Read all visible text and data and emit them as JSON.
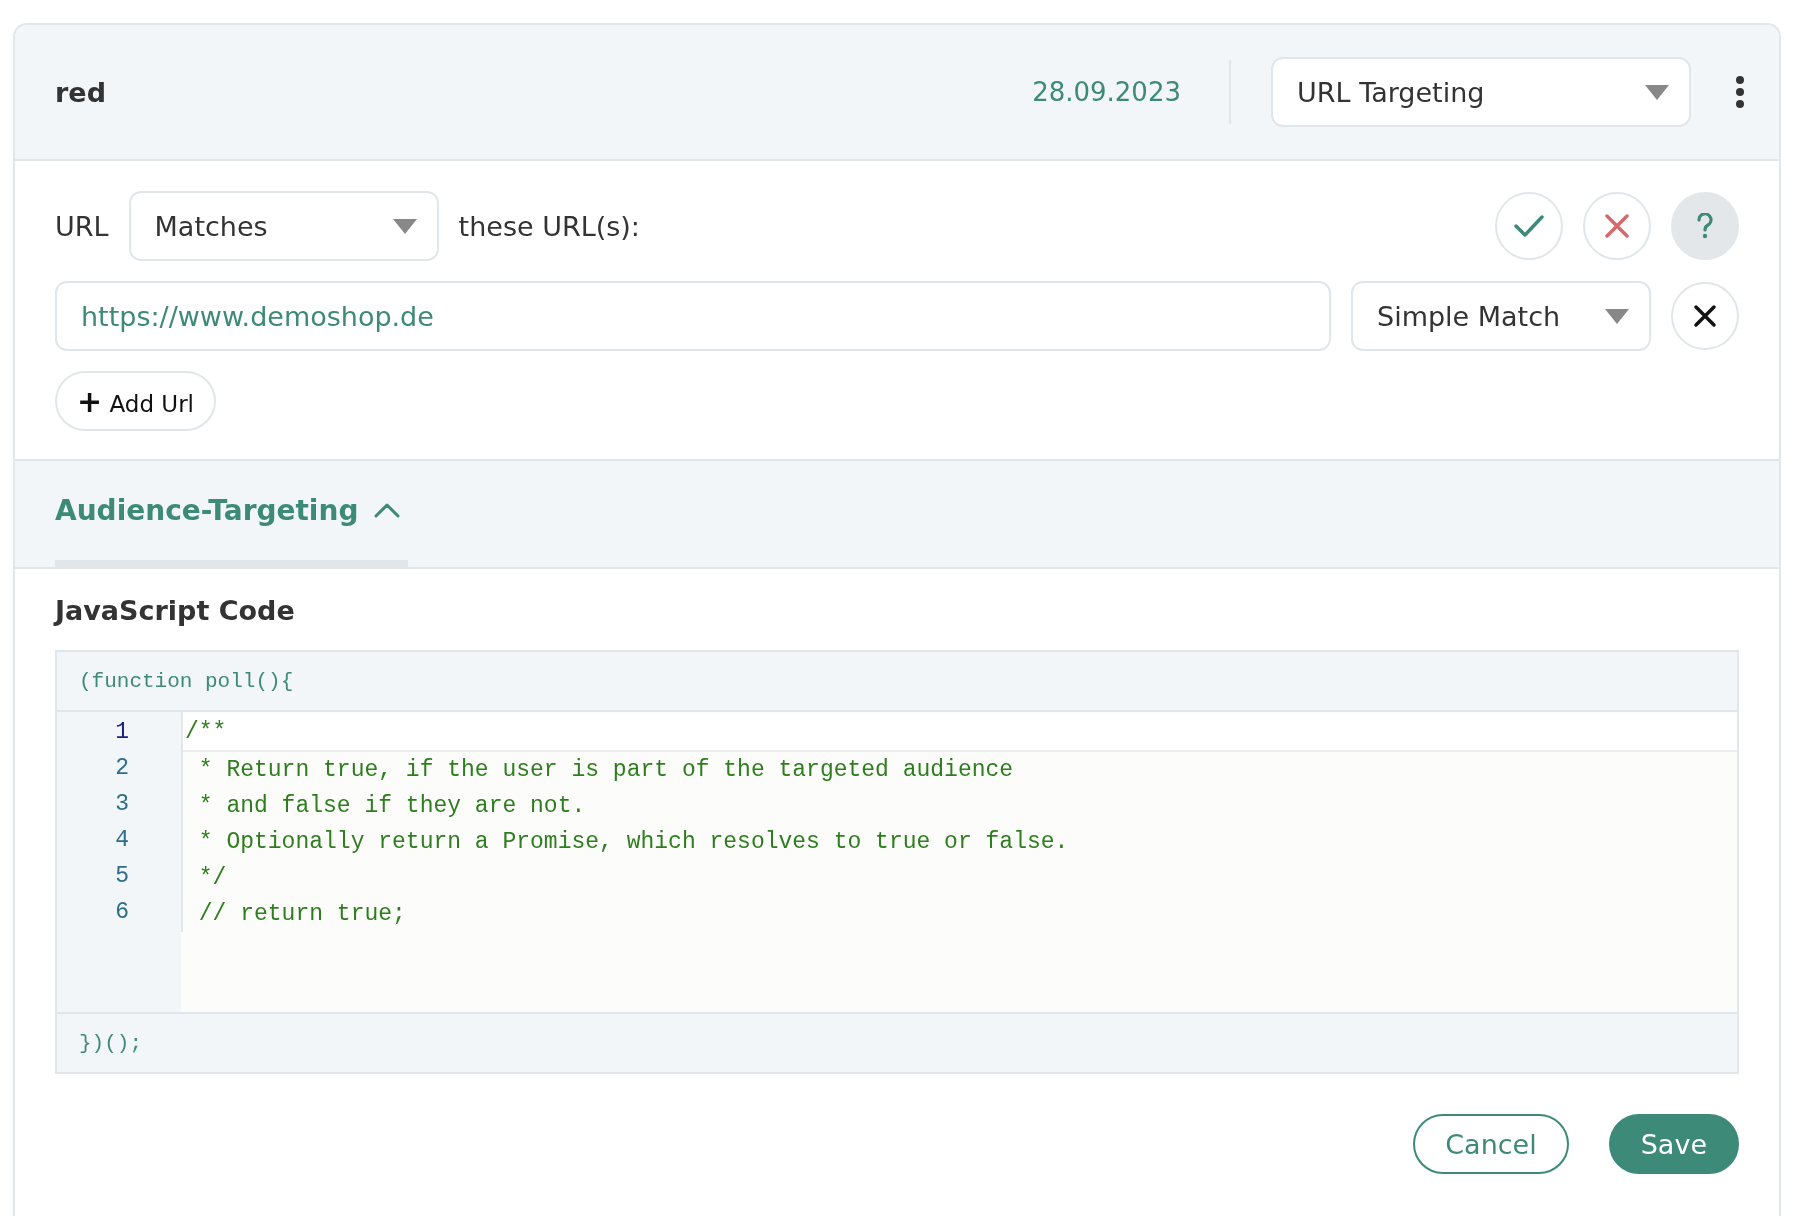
{
  "header": {
    "title": "red",
    "date": "28.09.2023",
    "type_select": {
      "value": "URL Targeting"
    }
  },
  "url_rule": {
    "label": "URL",
    "operator": {
      "value": "Matches"
    },
    "suffix": "these URL(s):",
    "urls": [
      {
        "value": "https://www.demoshop.de",
        "match": {
          "value": "Simple Match"
        }
      }
    ],
    "add_button": {
      "icon": "+",
      "label": "Add Url"
    }
  },
  "audience": {
    "title": "Audience-Targeting",
    "expanded": true,
    "code_label": "JavaScript Code",
    "prefix": "(function poll(){",
    "lines": [
      {
        "number": "1",
        "text": "/**",
        "active": true
      },
      {
        "number": "2",
        "text": " * Return true, if the user is part of the targeted audience",
        "active": false
      },
      {
        "number": "3",
        "text": " * and false if they are not.",
        "active": false
      },
      {
        "number": "4",
        "text": " * Optionally return a Promise, which resolves to true or false.",
        "active": false
      },
      {
        "number": "5",
        "text": " */",
        "active": false
      },
      {
        "number": "6",
        "text": " // return true;",
        "active": false
      }
    ],
    "suffix": "})();"
  },
  "buttons": [
    {
      "kind": "secondary",
      "label": "Cancel"
    },
    {
      "kind": "primary",
      "label": "Save"
    }
  ]
}
